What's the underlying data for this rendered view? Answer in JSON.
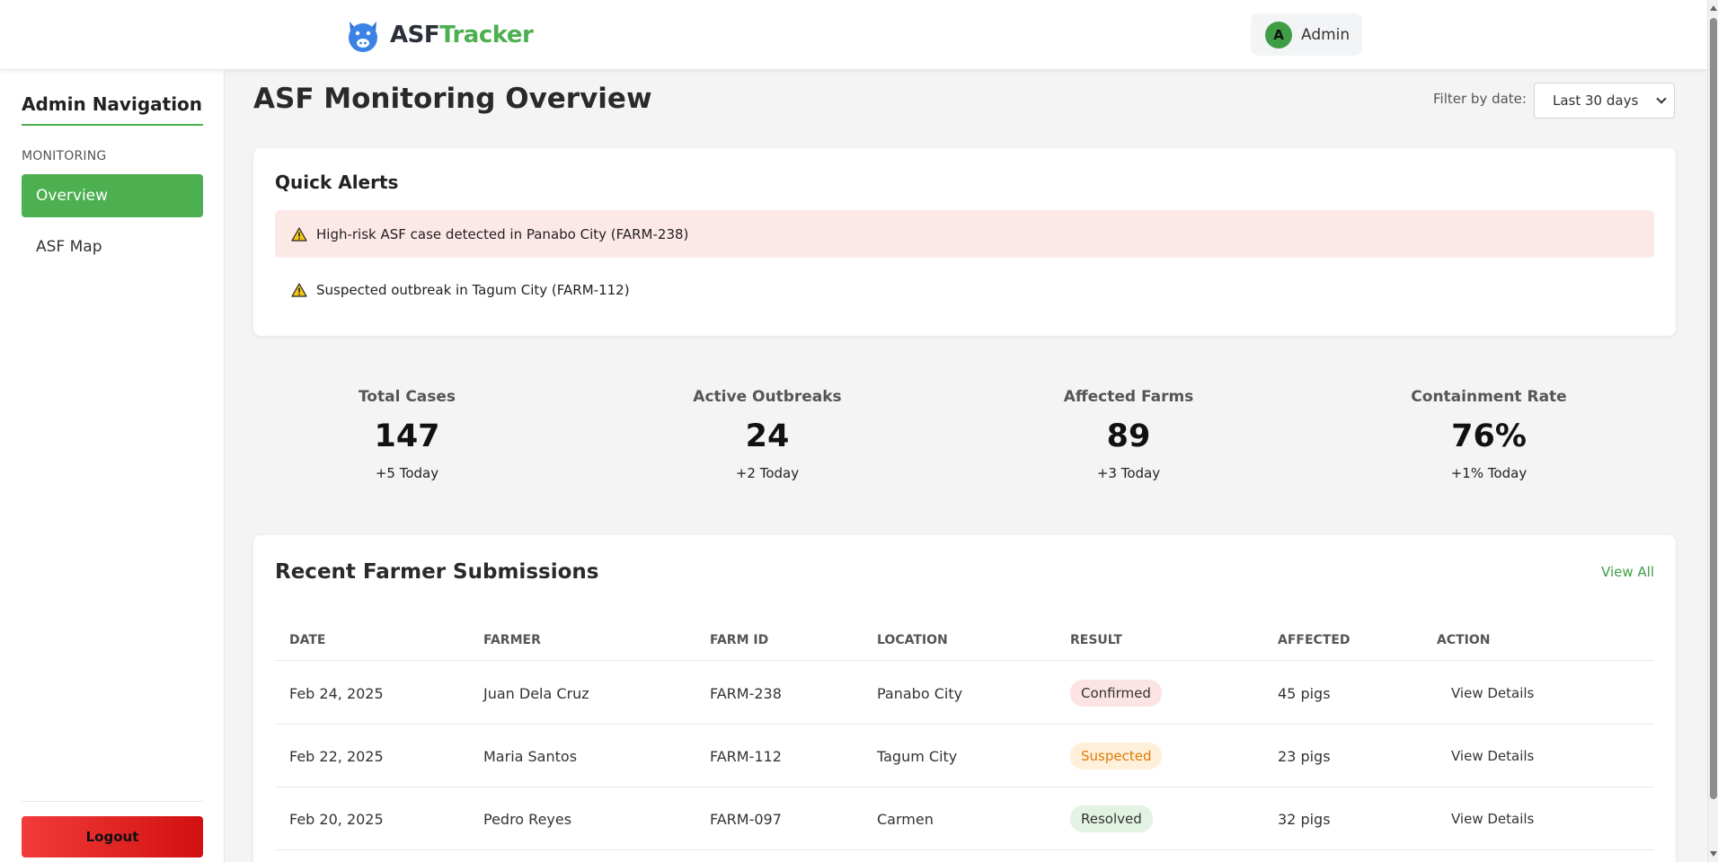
{
  "header": {
    "brand_part1": "ASF",
    "brand_part2": "Tracker",
    "user_initial": "A",
    "user_name": "Admin"
  },
  "sidebar": {
    "title": "Admin Navigation",
    "section": "MONITORING",
    "items": [
      {
        "label": "Overview",
        "active": true
      },
      {
        "label": "ASF Map",
        "active": false
      }
    ],
    "logout_label": "Logout"
  },
  "main": {
    "title": "ASF Monitoring Overview",
    "filter_label": "Filter by date:",
    "filter_value": "Last 30 days"
  },
  "alerts": {
    "title": "Quick Alerts",
    "items": [
      {
        "text": "High-risk ASF case detected in Panabo City (FARM-238)",
        "level": "high"
      },
      {
        "text": "Suspected outbreak in Tagum City (FARM-112)",
        "level": "medium"
      }
    ]
  },
  "stats": [
    {
      "label": "Total Cases",
      "value": "147",
      "delta": "+5 Today"
    },
    {
      "label": "Active Outbreaks",
      "value": "24",
      "delta": "+2 Today"
    },
    {
      "label": "Affected Farms",
      "value": "89",
      "delta": "+3 Today"
    },
    {
      "label": "Containment Rate",
      "value": "76%",
      "delta": "+1% Today"
    }
  ],
  "submissions": {
    "title": "Recent Farmer Submissions",
    "view_all": "View All",
    "columns": [
      "DATE",
      "FARMER",
      "FARM ID",
      "LOCATION",
      "RESULT",
      "AFFECTED",
      "ACTION"
    ],
    "rows": [
      {
        "date": "Feb 24, 2025",
        "farmer": "Juan Dela Cruz",
        "farm_id": "FARM-238",
        "location": "Panabo City",
        "result": "Confirmed",
        "affected": "45 pigs",
        "action": "View Details"
      },
      {
        "date": "Feb 22, 2025",
        "farmer": "Maria Santos",
        "farm_id": "FARM-112",
        "location": "Tagum City",
        "result": "Suspected",
        "affected": "23 pigs",
        "action": "View Details"
      },
      {
        "date": "Feb 20, 2025",
        "farmer": "Pedro Reyes",
        "farm_id": "FARM-097",
        "location": "Carmen",
        "result": "Resolved",
        "affected": "32 pigs",
        "action": "View Details"
      }
    ]
  },
  "colors": {
    "accent": "#4caf50",
    "logout": "#e02424",
    "alert_high_bg": "#fde8e8",
    "suspected_text": "#e07b00"
  },
  "icons": {
    "logo": "pig-icon",
    "alert": "warning-icon"
  }
}
